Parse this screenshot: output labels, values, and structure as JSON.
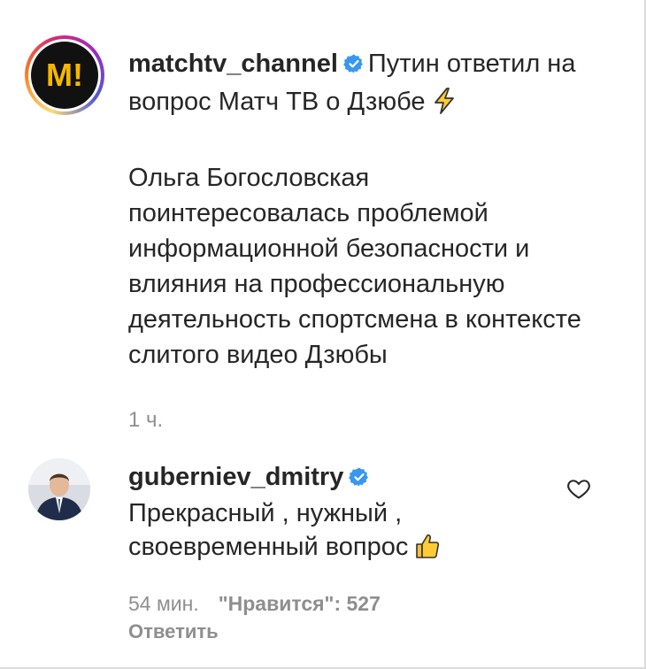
{
  "post": {
    "username": "matchtv_channel",
    "avatar_logo": "М!",
    "caption_title": "Путин ответил на вопрос Матч ТВ о Дзюбе",
    "caption_title_emoji": "lightning-emoji",
    "caption_body": "Ольга Богословская поинтересовалась проблемой информационной безопасности и влияния на профессиональную деятельность спортсмена в контексте слитого видео Дзюбы",
    "time": "1 ч."
  },
  "comment": {
    "username": "guberniev_dmitry",
    "text": "Прекрасный , нужный , своевременный вопрос",
    "text_emoji": "thumbs-up-emoji",
    "time": "54 мин.",
    "likes": "\"Нравится\": 527",
    "reply_label": "Ответить",
    "like_icon": "heart-outline-icon"
  },
  "colors": {
    "verified_blue": "#3897f0",
    "meta_gray": "#8e8e8e",
    "text_dark": "#262626",
    "match_logo_gold": "#f5b800"
  }
}
